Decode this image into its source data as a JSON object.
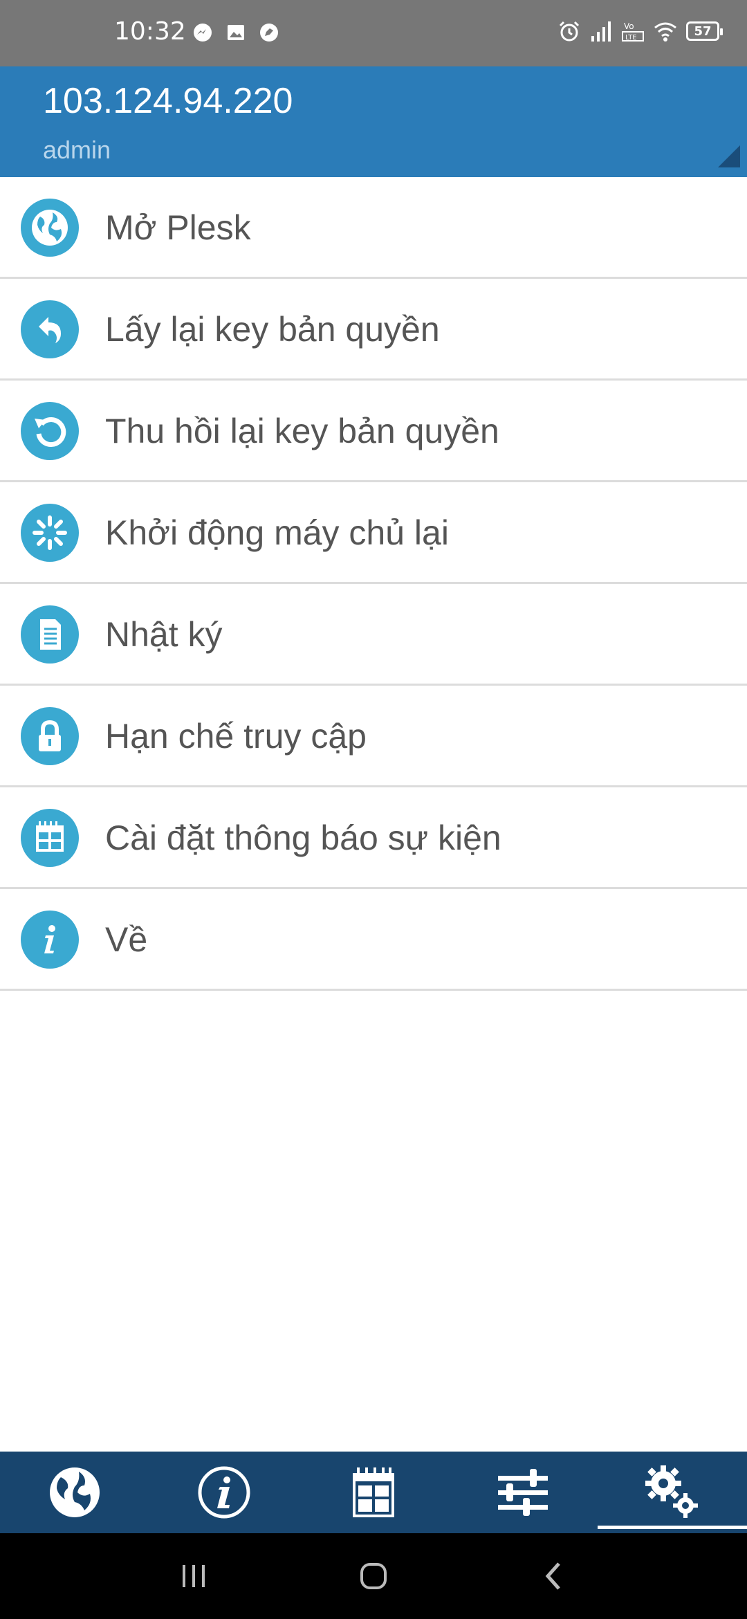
{
  "status_bar": {
    "time": "10:32",
    "left_icons": [
      "messenger-icon",
      "image-icon",
      "chat-bubble-icon"
    ],
    "right_icons": [
      "alarm-icon",
      "signal-icon",
      "volte-lte-icon",
      "wifi-icon"
    ],
    "battery": "57"
  },
  "header": {
    "ip": "103.124.94.220",
    "user": "admin",
    "bg_color": "#2b7cb8"
  },
  "menu": {
    "items": [
      {
        "label": "Mở Plesk",
        "icon": "globe-icon"
      },
      {
        "label": "Lấy lại key bản quyền",
        "icon": "undo-arrow-icon"
      },
      {
        "label": "Thu hồi lại key bản quyền",
        "icon": "revoke-circle-arrow-icon"
      },
      {
        "label": "Khởi động máy chủ lại",
        "icon": "loading-spinner-icon"
      },
      {
        "label": "Nhật ký",
        "icon": "document-icon"
      },
      {
        "label": "Hạn chế truy cập",
        "icon": "lock-icon"
      },
      {
        "label": "Cài đặt thông báo sự kiện",
        "icon": "calendar-icon"
      },
      {
        "label": "Về",
        "icon": "info-icon"
      }
    ],
    "icon_color": "#3aa9d1"
  },
  "tab_bar": {
    "tabs": [
      {
        "icon": "globe-icon",
        "selected": false
      },
      {
        "icon": "info-icon",
        "selected": false
      },
      {
        "icon": "calendar-icon",
        "selected": false
      },
      {
        "icon": "sliders-icon",
        "selected": false
      },
      {
        "icon": "gears-icon",
        "selected": true
      }
    ],
    "bg_color": "#18456e"
  },
  "nav_bar": {
    "buttons": [
      "recents-icon",
      "home-icon",
      "back-icon"
    ]
  }
}
